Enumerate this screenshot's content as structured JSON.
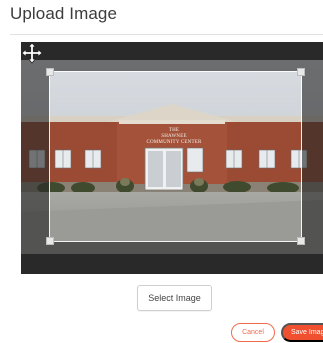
{
  "dialog": {
    "title": "Upload Image"
  },
  "cropper": {
    "image_alt": "Community center building photo",
    "sign_line1": "THE",
    "sign_line2": "SHAWNEE",
    "sign_line3": "COMMUNITY CENTER",
    "cursor_icon": "move-icon"
  },
  "actions": {
    "select_label": "Select Image",
    "cancel_label": "Cancel",
    "save_label": "Save Image"
  },
  "colors": {
    "accent": "#f0502f",
    "overlay": "#2c2c2c"
  }
}
